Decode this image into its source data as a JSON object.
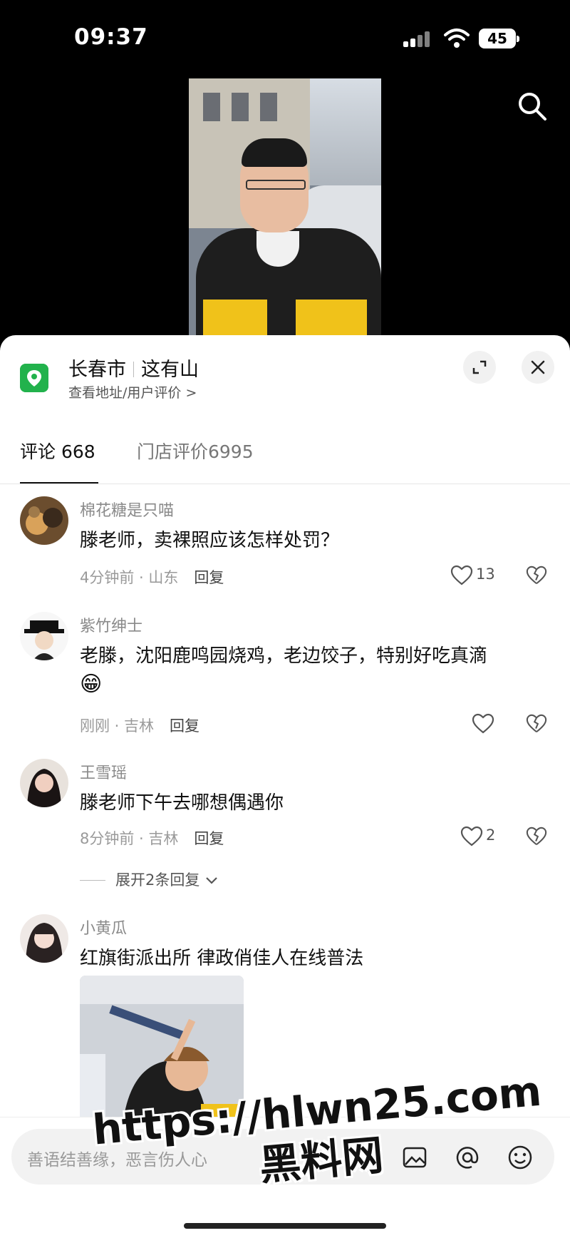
{
  "status_bar": {
    "time": "09:37",
    "battery": "45"
  },
  "location": {
    "city": "长春市",
    "place": "这有山",
    "subtitle": "查看地址/用户评价 >"
  },
  "tabs": {
    "comments": "评论 668",
    "reviews": "门店评价6995"
  },
  "comments": [
    {
      "name": "棉花糖是只喵",
      "text": "滕老师，卖裸照应该怎样处罚？",
      "meta": "4分钟前 · 山东",
      "reply": "回复",
      "likes": "13"
    },
    {
      "name": "紫竹绅士",
      "text": "老滕，沈阳鹿鸣园烧鸡，老边饺子，特别好吃真滴",
      "emoji": "😁",
      "meta": "刚刚 · 吉林",
      "reply": "回复",
      "likes": ""
    },
    {
      "name": "王雪瑶",
      "text": "滕老师下午去哪想偶遇你",
      "meta": "8分钟前 · 吉林",
      "reply": "回复",
      "likes": "2"
    },
    {
      "name": "小黄瓜",
      "text": "红旗街派出所 律政俏佳人在线普法"
    }
  ],
  "expand_replies": "展开2条回复",
  "input": {
    "placeholder": "善语结善缘，恶言伤人心"
  },
  "watermark": {
    "line1": "https://hlwn25.com",
    "line2": "黑料网"
  },
  "colors": {
    "accent_green": "#22b24c",
    "sheet_bg": "#ffffff",
    "video_bg": "#000000"
  }
}
